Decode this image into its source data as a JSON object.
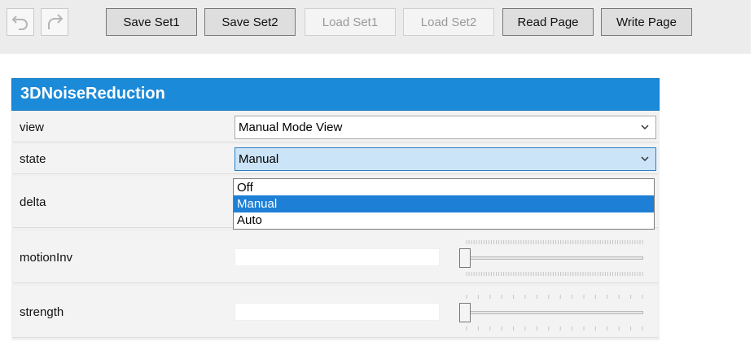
{
  "toolbar": {
    "undo_icon": "undo-icon",
    "redo_icon": "redo-icon",
    "save_set1": "Save Set1",
    "save_set2": "Save Set2",
    "load_set1": "Load Set1",
    "load_set2": "Load Set2",
    "read_page": "Read Page",
    "write_page": "Write Page"
  },
  "panel": {
    "title": "3DNoiseReduction",
    "header_color": "#1b8ad8",
    "rows": {
      "view": {
        "label": "view",
        "value": "Manual Mode View"
      },
      "state": {
        "label": "state",
        "value": "Manual",
        "options": [
          "Off",
          "Manual",
          "Auto"
        ],
        "selected_option": "Manual"
      },
      "delta": {
        "label": "delta"
      },
      "motionInv": {
        "label": "motionInv",
        "slider_level": 0
      },
      "strength": {
        "label": "strength",
        "slider_level": 0
      }
    }
  }
}
